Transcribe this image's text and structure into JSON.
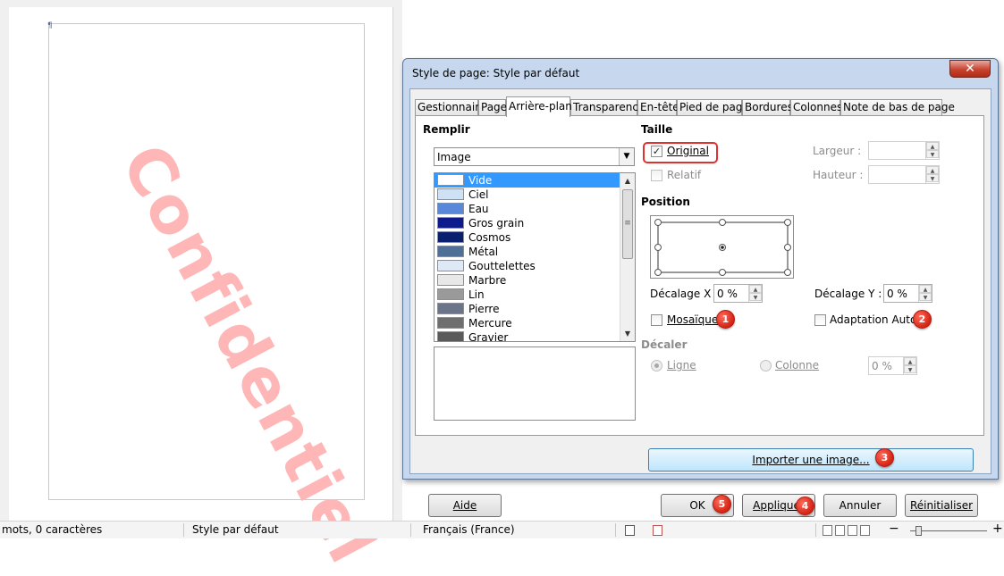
{
  "document": {
    "watermark_text": "Confidentiel",
    "paragraph_mark": "¶"
  },
  "statusbar": {
    "word_count": "mots, 0 caractères",
    "page_style": "Style par défaut",
    "language": "Français (France)",
    "zoom_minus": "−",
    "zoom_plus": "+"
  },
  "dialog": {
    "title": "Style de page: Style par défaut",
    "close_glyph": "✕",
    "tabs": [
      {
        "label": "Gestionnaire"
      },
      {
        "label": "Page"
      },
      {
        "label": "Arrière-plan"
      },
      {
        "label": "Transparence"
      },
      {
        "label": "En-tête"
      },
      {
        "label": "Pied de page"
      },
      {
        "label": "Bordures"
      },
      {
        "label": "Colonnes"
      },
      {
        "label": "Note de bas de page"
      }
    ],
    "fill": {
      "heading": "Remplir",
      "selected": "Image",
      "items": [
        {
          "name": "Vide",
          "color": "#ffffff"
        },
        {
          "name": "Ciel",
          "color": "#cfe2f5"
        },
        {
          "name": "Eau",
          "color": "#5a88d8"
        },
        {
          "name": "Gros grain",
          "color": "#0d1a8c"
        },
        {
          "name": "Cosmos",
          "color": "#0a1f6e"
        },
        {
          "name": "Métal",
          "color": "#4f6f97"
        },
        {
          "name": "Gouttelettes",
          "color": "#dfe8f5"
        },
        {
          "name": "Marbre",
          "color": "#e8e8e8"
        },
        {
          "name": "Lin",
          "color": "#9a9a9a"
        },
        {
          "name": "Pierre",
          "color": "#6b7488"
        },
        {
          "name": "Mercure",
          "color": "#6e6e6e"
        },
        {
          "name": "Gravier",
          "color": "#5a5a5a"
        }
      ]
    },
    "size": {
      "heading": "Taille",
      "original_label": "Original",
      "original_checked": true,
      "relative_label": "Relatif",
      "width_label": "Largeur :",
      "height_label": "Hauteur :"
    },
    "position": {
      "heading": "Position",
      "offset_x_label": "Décalage X",
      "offset_x_value": "0 %",
      "offset_y_label": "Décalage Y :",
      "offset_y_value": "0 %",
      "tile_label": "Mosaïque",
      "autofit_label": "Adaptation Auto"
    },
    "shift": {
      "heading": "Décaler",
      "row_label": "Ligne",
      "column_label": "Colonne",
      "value": "0 %"
    },
    "import_button": "Importer une image...",
    "buttons": {
      "help": "Aide",
      "ok": "OK",
      "apply": "Appliquer",
      "cancel": "Annuler",
      "reset": "Réinitialiser"
    },
    "markers": [
      "1",
      "2",
      "3",
      "4",
      "5"
    ],
    "colors": {
      "accent": "#3399ff",
      "marker": "#d42414",
      "watermark": "#ffb6b6"
    }
  }
}
